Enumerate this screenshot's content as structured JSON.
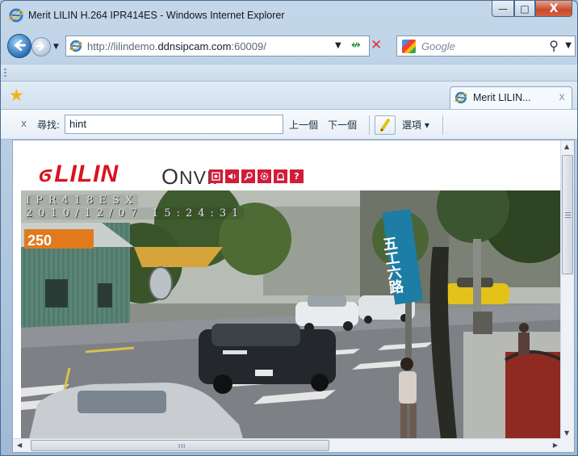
{
  "window": {
    "title": "Merit LILIN H.264 IPR414ES - Windows Internet Explorer",
    "buttons": {
      "minimize": "—",
      "maximize": "□",
      "close": "X"
    }
  },
  "address_bar": {
    "url_prefix": "http://lilindemo.",
    "url_domain": "ddnsipcam.com",
    "url_suffix": ":60009/"
  },
  "search_bar": {
    "placeholder": "Google"
  },
  "tab": {
    "label": "Merit LILIN...",
    "close": "x"
  },
  "find_bar": {
    "close": "x",
    "label": "尋找:",
    "query": "hint",
    "prev": "上一個",
    "next": "下一個",
    "options": "選項 ▾"
  },
  "page": {
    "logo_text": "LILIN",
    "logo_mark": "ϭ",
    "onvif_text": "NVIF",
    "onvif_o": "O",
    "camera_icons": [
      "camera-snapshot-icon",
      "audio-icon",
      "search-icon",
      "settings-icon",
      "alarm-icon",
      "help-icon"
    ],
    "help_glyph": "?",
    "osd_line1": "IPR418ESX",
    "osd_line2": "2010/12/07 15:24:31",
    "sign_250": "250",
    "street_sign": "五工六路"
  },
  "scrollbar": {
    "hscroll_grip": "III"
  },
  "colors": {
    "brand_red": "#d8141f",
    "icon_red": "#d01d3a"
  }
}
